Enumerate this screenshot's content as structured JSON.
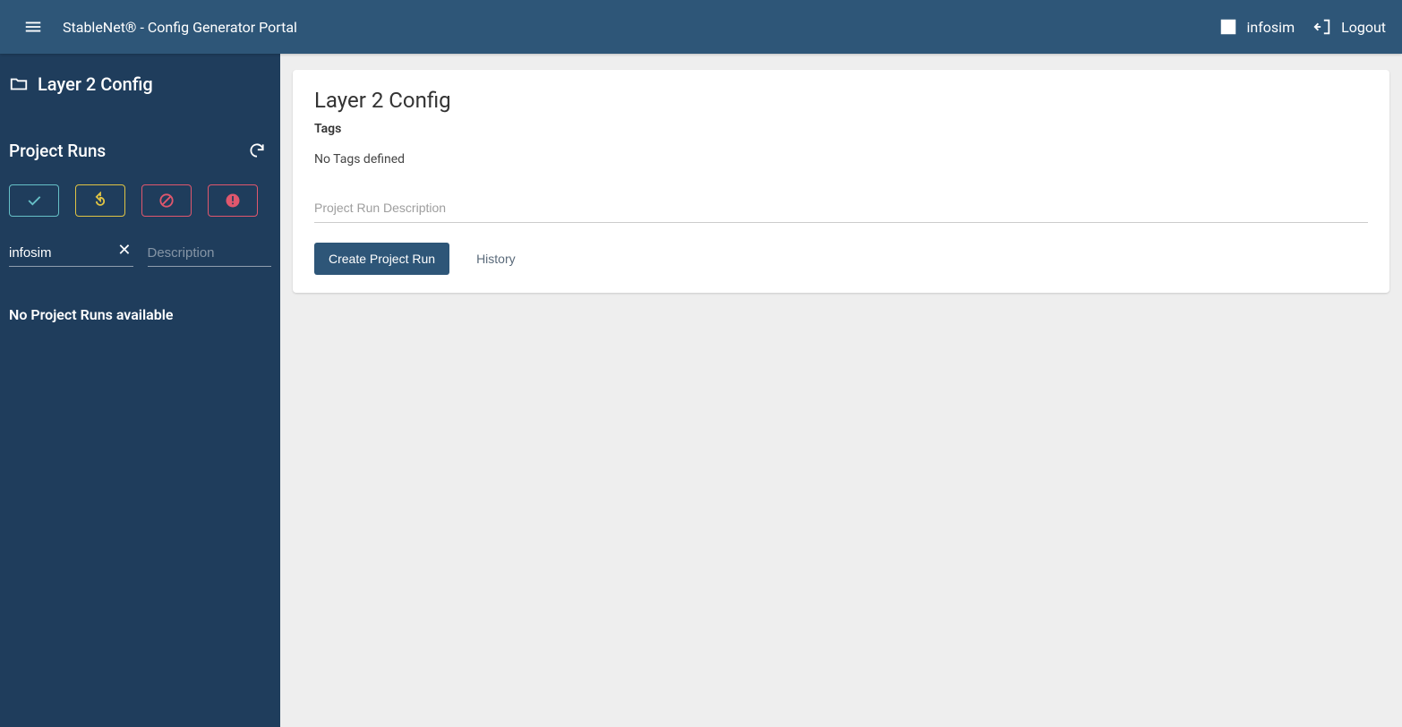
{
  "header": {
    "app_title": "StableNet® - Config Generator Portal",
    "user_label": "infosim",
    "logout_label": "Logout"
  },
  "sidebar": {
    "project_name": "Layer 2 Config",
    "section_title": "Project Runs",
    "filter_user_value": "infosim",
    "filter_desc_placeholder": "Description",
    "empty_message": "No Project Runs available"
  },
  "main": {
    "title": "Layer 2 Config",
    "tags_label": "Tags",
    "tags_empty": "No Tags defined",
    "desc_placeholder": "Project Run Description",
    "create_btn": "Create Project Run",
    "history_btn": "History"
  }
}
